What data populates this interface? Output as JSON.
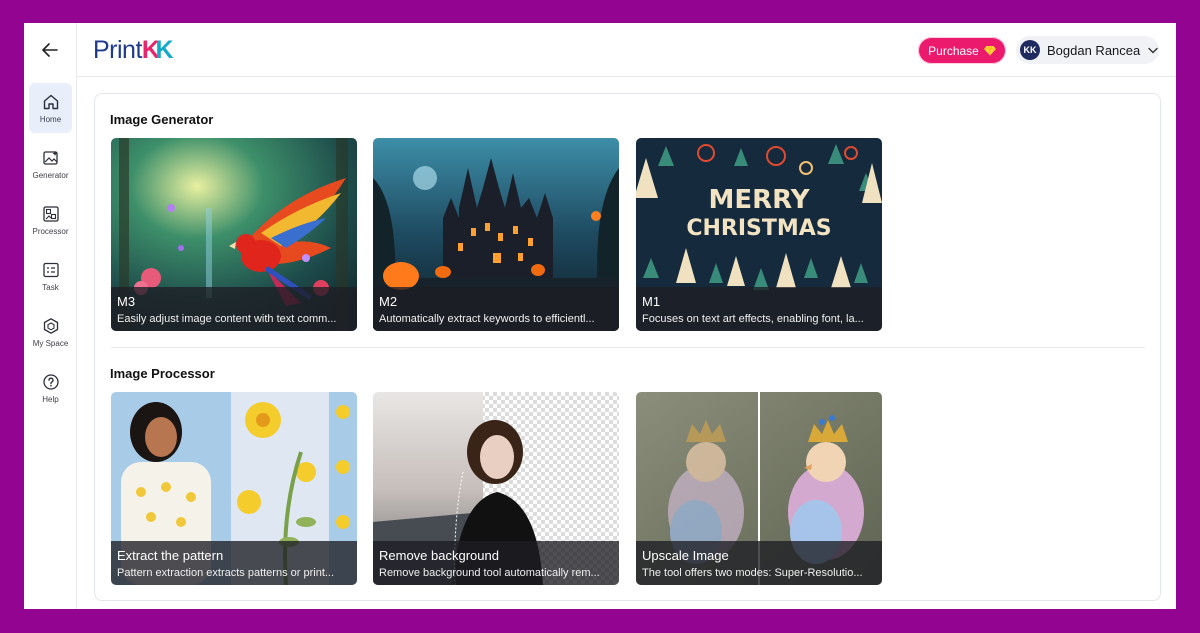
{
  "header": {
    "logo_print": "Print",
    "logo_k1": "K",
    "logo_k2": "K",
    "purchase_label": "Purchase",
    "user_name": "Bogdan Rancea",
    "avatar_initials": "KK"
  },
  "sidebar": {
    "items": [
      {
        "label": "Home",
        "icon": "home-icon",
        "active": true
      },
      {
        "label": "Generator",
        "icon": "image-sparkle-icon",
        "active": false
      },
      {
        "label": "Processor",
        "icon": "image-grid-icon",
        "active": false
      },
      {
        "label": "Task",
        "icon": "task-list-icon",
        "active": false
      },
      {
        "label": "My Space",
        "icon": "cube-icon",
        "active": false
      },
      {
        "label": "Help",
        "icon": "help-icon",
        "active": false
      }
    ]
  },
  "sections": {
    "generator": {
      "title": "Image Generator",
      "cards": [
        {
          "title": "M3",
          "desc": "Easily adjust image content with text comm..."
        },
        {
          "title": "M2",
          "desc": "Automatically extract keywords to efficientl..."
        },
        {
          "title": "M1",
          "desc": "Focuses on text art effects, enabling font, la..."
        }
      ]
    },
    "processor": {
      "title": "Image Processor",
      "cards": [
        {
          "title": "Extract the pattern",
          "desc": "Pattern extraction extracts patterns or print..."
        },
        {
          "title": "Remove background",
          "desc": "Remove background tool automatically rem..."
        },
        {
          "title": "Upscale Image",
          "desc": "The tool offers two modes: Super-Resolutio..."
        }
      ]
    }
  },
  "art_text": {
    "m1_line1": "MERRY",
    "m1_line2": "CHRISTMAS"
  },
  "colors": {
    "background": "#930490",
    "brand_blue": "#1f3a8c",
    "brand_pink": "#e8256b",
    "brand_cyan": "#17a9c9",
    "purchase": "#ec1a6d",
    "active_nav": "#e8effb"
  }
}
